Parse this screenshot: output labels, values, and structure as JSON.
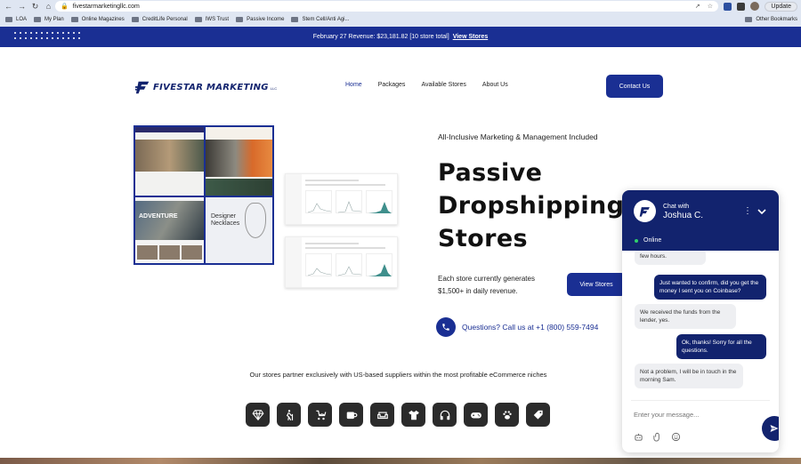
{
  "browser": {
    "url": "fivestarmarketingllc.com",
    "update_label": "Update",
    "bookmarks": [
      "LOA",
      "My Plan",
      "Online Magazines",
      "CreditLife Personal",
      "IWS Trust",
      "Passive Income",
      "Stem Cell/Anti Agi..."
    ],
    "other_bookmarks": "Other Bookmarks"
  },
  "banner": {
    "text": "February 27 Revenue: $23,181.82 [10 store total]",
    "link": "View Stores"
  },
  "header": {
    "logo_text": "FIVESTAR MARKETING",
    "logo_sub": "LLC",
    "nav": [
      "Home",
      "Packages",
      "Available Stores",
      "About Us"
    ],
    "contact_label": "Contact Us"
  },
  "hero": {
    "kicker": "All-Inclusive Marketing & Management Included",
    "headline": [
      "Passive",
      "Dropshipping",
      "Stores"
    ],
    "subtext": [
      "Each store currently generates",
      "$1,500+ in daily revenue."
    ],
    "view_stores_label": "View Stores",
    "phone_text": "Questions? Call us at +1 (800) 559-7494",
    "collage": {
      "t3_word": "ADVENTURE",
      "t4_word": [
        "Designer",
        "Necklaces"
      ]
    }
  },
  "partners_text": "Our stores partner exclusively with US-based suppliers within the most profitable eCommerce niches",
  "niche_icons": [
    "diamond-icon",
    "hiking-icon",
    "stroller-icon",
    "mug-icon",
    "sofa-icon",
    "tshirt-icon",
    "headphones-icon",
    "gamepad-icon",
    "paw-icon",
    "tag-icon"
  ],
  "chat": {
    "title": "Chat with",
    "agent": "Joshua C.",
    "status": "Online",
    "messages": [
      {
        "from": "in",
        "text": "few hours."
      },
      {
        "from": "out",
        "text": "Just wanted to confirm, did you get the money I sent you on Coinbase?"
      },
      {
        "from": "in",
        "text": "We received the funds from the lender, yes."
      },
      {
        "from": "out",
        "text": "Ok, thanks! Sorry for all the questions."
      },
      {
        "from": "in",
        "text": "Not a problem, I will be in touch in the morning Sam."
      }
    ],
    "input_placeholder": "Enter your message..."
  },
  "colors": {
    "brand": "#1a2f93",
    "chat_header": "#12236e",
    "online": "#2fcf6b"
  }
}
